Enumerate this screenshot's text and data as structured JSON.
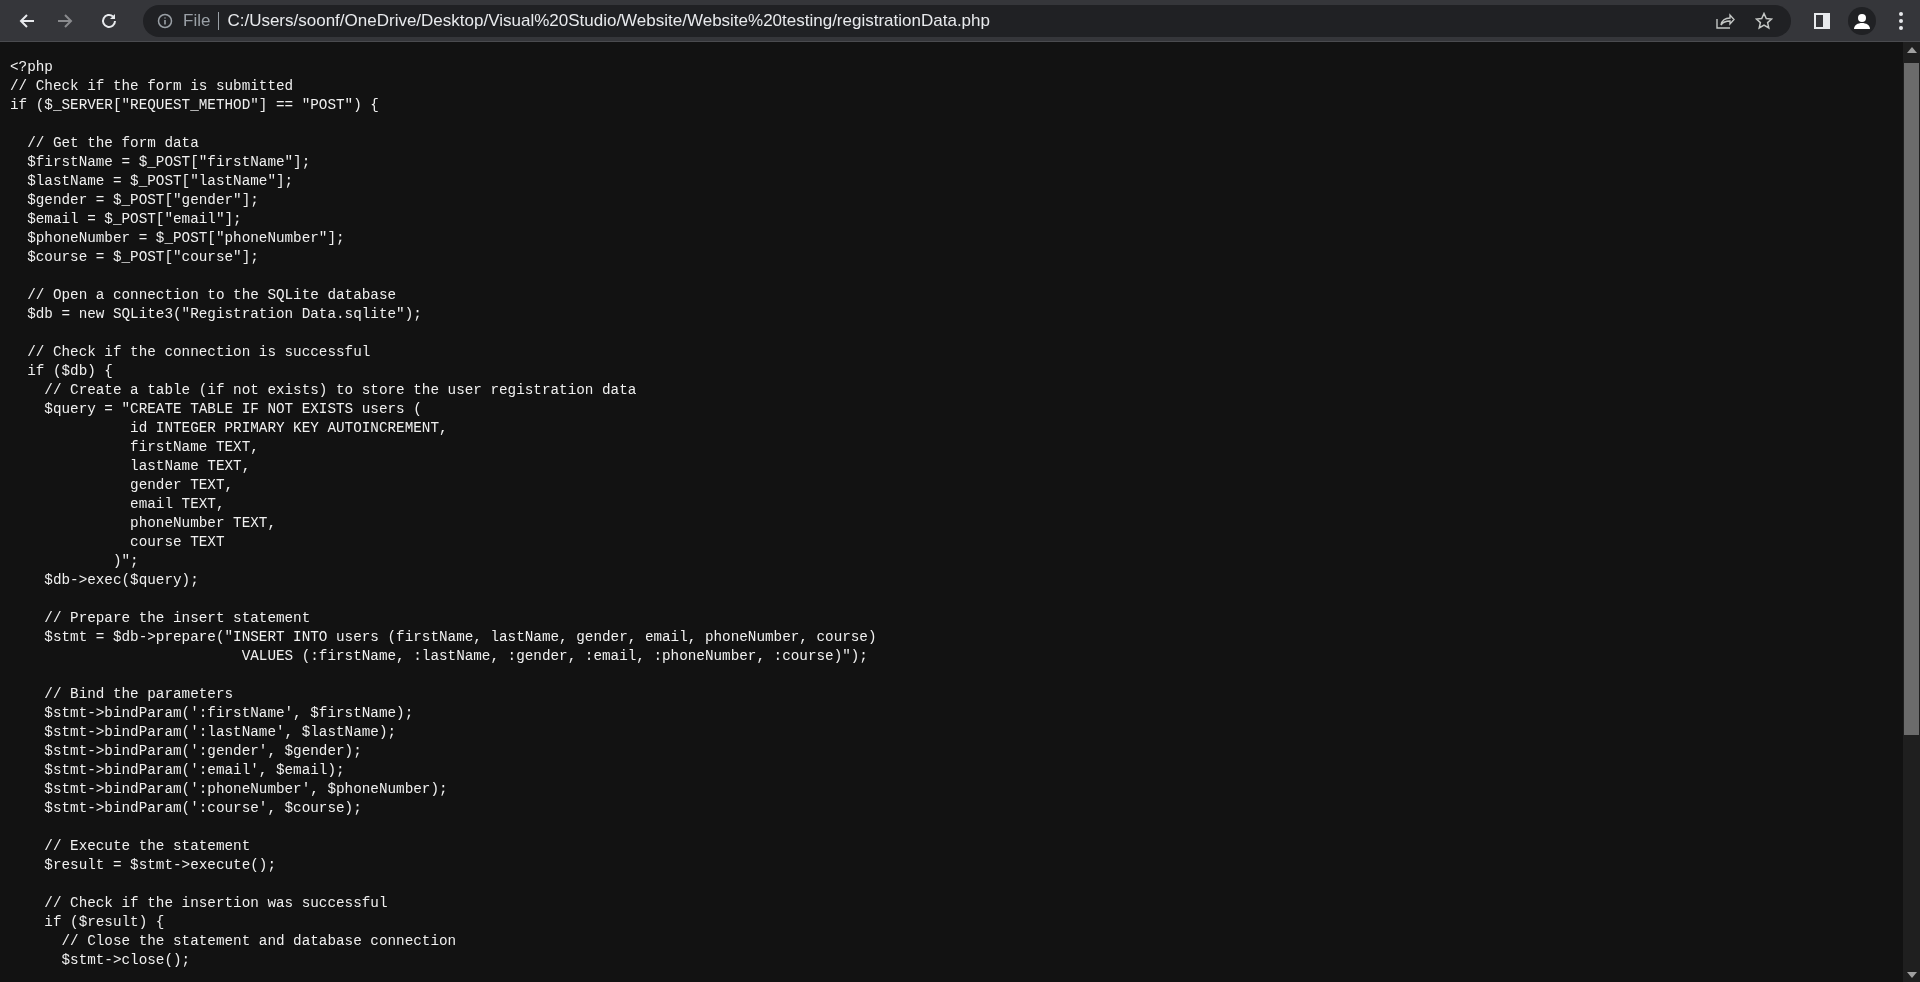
{
  "toolbar": {
    "scheme_label": "File",
    "url": "C:/Users/soonf/OneDrive/Desktop/Visual%20Studio/Website/Website%20testing/registrationData.php",
    "forward_disabled": true
  },
  "page": {
    "code": "<?php\n// Check if the form is submitted\nif ($_SERVER[\"REQUEST_METHOD\"] == \"POST\") {\n\n  // Get the form data\n  $firstName = $_POST[\"firstName\"];\n  $lastName = $_POST[\"lastName\"];\n  $gender = $_POST[\"gender\"];\n  $email = $_POST[\"email\"];\n  $phoneNumber = $_POST[\"phoneNumber\"];\n  $course = $_POST[\"course\"];\n\n  // Open a connection to the SQLite database\n  $db = new SQLite3(\"Registration Data.sqlite\");\n\n  // Check if the connection is successful\n  if ($db) {\n    // Create a table (if not exists) to store the user registration data\n    $query = \"CREATE TABLE IF NOT EXISTS users (\n              id INTEGER PRIMARY KEY AUTOINCREMENT,\n              firstName TEXT,\n              lastName TEXT,\n              gender TEXT,\n              email TEXT,\n              phoneNumber TEXT,\n              course TEXT\n            )\";\n    $db->exec($query);\n\n    // Prepare the insert statement\n    $stmt = $db->prepare(\"INSERT INTO users (firstName, lastName, gender, email, phoneNumber, course)\n                           VALUES (:firstName, :lastName, :gender, :email, :phoneNumber, :course)\");\n\n    // Bind the parameters\n    $stmt->bindParam(':firstName', $firstName);\n    $stmt->bindParam(':lastName', $lastName);\n    $stmt->bindParam(':gender', $gender);\n    $stmt->bindParam(':email', $email);\n    $stmt->bindParam(':phoneNumber', $phoneNumber);\n    $stmt->bindParam(':course', $course);\n\n    // Execute the statement\n    $result = $stmt->execute();\n\n    // Check if the insertion was successful\n    if ($result) {\n      // Close the statement and database connection\n      $stmt->close();"
  }
}
